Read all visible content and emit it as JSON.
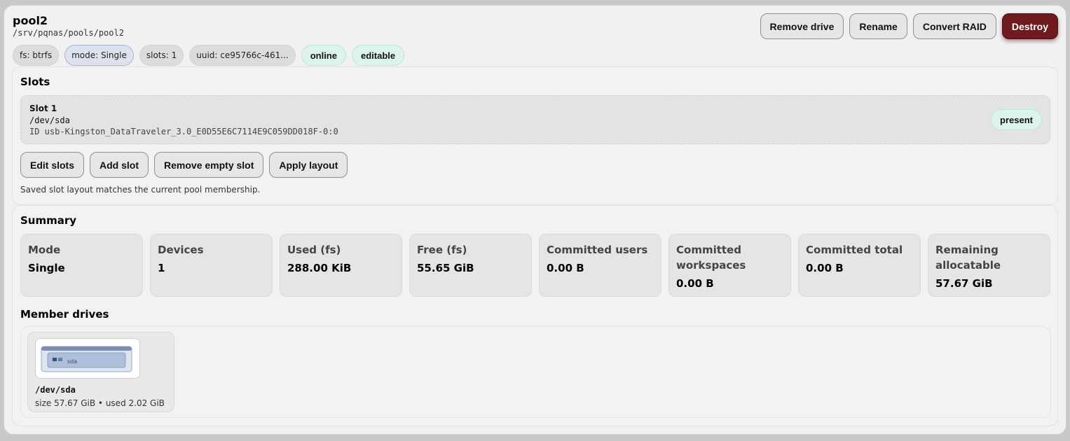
{
  "pool": {
    "name": "pool2",
    "path": "/srv/pqnas/pools/pool2",
    "chips": {
      "fs": "fs: btrfs",
      "mode": "mode: Single",
      "slots": "slots: 1",
      "uuid": "uuid: ce95766c-461...",
      "online": "online",
      "editable": "editable"
    }
  },
  "actions": {
    "remove_drive": "Remove drive",
    "rename": "Rename",
    "convert_raid": "Convert RAID",
    "destroy": "Destroy"
  },
  "slots": {
    "title": "Slots",
    "items": [
      {
        "name": "Slot 1",
        "device": "/dev/sda",
        "id": "ID usb-Kingston_DataTraveler_3.0_E0D55E6C7114E9C059DD018F-0:0",
        "status": "present"
      }
    ],
    "buttons": {
      "edit": "Edit slots",
      "add": "Add slot",
      "remove_empty": "Remove empty slot",
      "apply": "Apply layout"
    },
    "note": "Saved slot layout matches the current pool membership."
  },
  "summary": {
    "title": "Summary",
    "tiles": [
      {
        "label": "Mode",
        "value": "Single"
      },
      {
        "label": "Devices",
        "value": "1"
      },
      {
        "label": "Used (fs)",
        "value": "288.00 KiB"
      },
      {
        "label": "Free (fs)",
        "value": "55.65 GiB"
      },
      {
        "label": "Committed users",
        "value": "0.00 B"
      },
      {
        "label": "Committed workspaces",
        "value": "0.00 B"
      },
      {
        "label": "Committed total",
        "value": "0.00 B"
      },
      {
        "label": "Remaining allocatable",
        "value": "57.67 GiB"
      }
    ]
  },
  "member_drives": {
    "title": "Member drives",
    "drives": [
      {
        "image_label": "sda",
        "name": "/dev/sda",
        "meta": "size 57.67 GiB • used 2.02 GiB"
      }
    ]
  },
  "colors": {
    "destroy_bg": "#6e1a1f",
    "ok_chip_bg": "#dcf3ee",
    "mode_chip_bg": "#dde3ee",
    "card_bg": "#f1f1f1"
  }
}
